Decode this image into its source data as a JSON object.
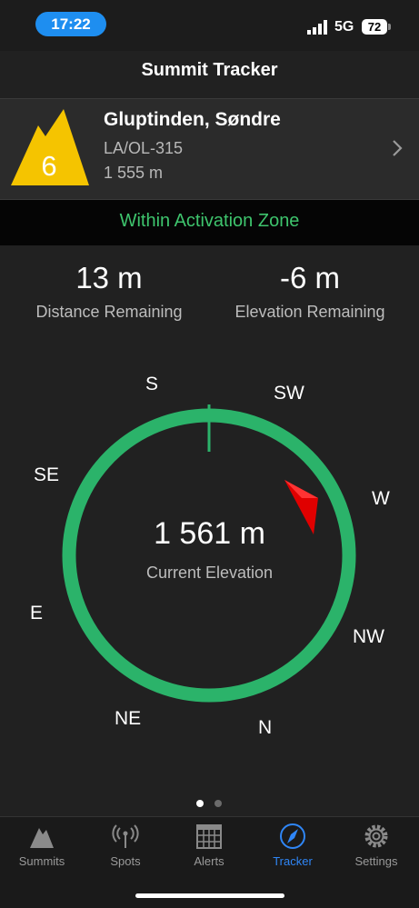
{
  "status_bar": {
    "time": "17:22",
    "network": "5G",
    "battery": "72"
  },
  "nav": {
    "title": "Summit Tracker"
  },
  "summit": {
    "points": "6",
    "name": "Gluptinden, Søndre",
    "reference": "LA/OL-315",
    "altitude": "1 555 m",
    "badge_color": "#f5c400"
  },
  "activation": {
    "status": "Within Activation Zone",
    "color": "#3ec46d"
  },
  "stats": {
    "distance_value": "13 m",
    "distance_label": "Distance Remaining",
    "elevation_value": "-6 m",
    "elevation_label": "Elevation Remaining"
  },
  "compass": {
    "directions": {
      "s": "S",
      "sw": "SW",
      "w": "W",
      "nw": "NW",
      "n": "N",
      "ne": "NE",
      "e": "E",
      "se": "SE"
    },
    "current_elevation": "1 561 m",
    "current_elevation_label": "Current Elevation",
    "ring_color": "#2bb36a",
    "pointer_color": "#e00000"
  },
  "pager": {
    "pages": 2,
    "current": 1
  },
  "tabs": [
    {
      "label": "Summits",
      "icon": "mountain-icon"
    },
    {
      "label": "Spots",
      "icon": "antenna-icon"
    },
    {
      "label": "Alerts",
      "icon": "calendar-icon"
    },
    {
      "label": "Tracker",
      "icon": "compass-icon",
      "active": true
    },
    {
      "label": "Settings",
      "icon": "gear-icon"
    }
  ],
  "accent_color": "#2f86f6"
}
